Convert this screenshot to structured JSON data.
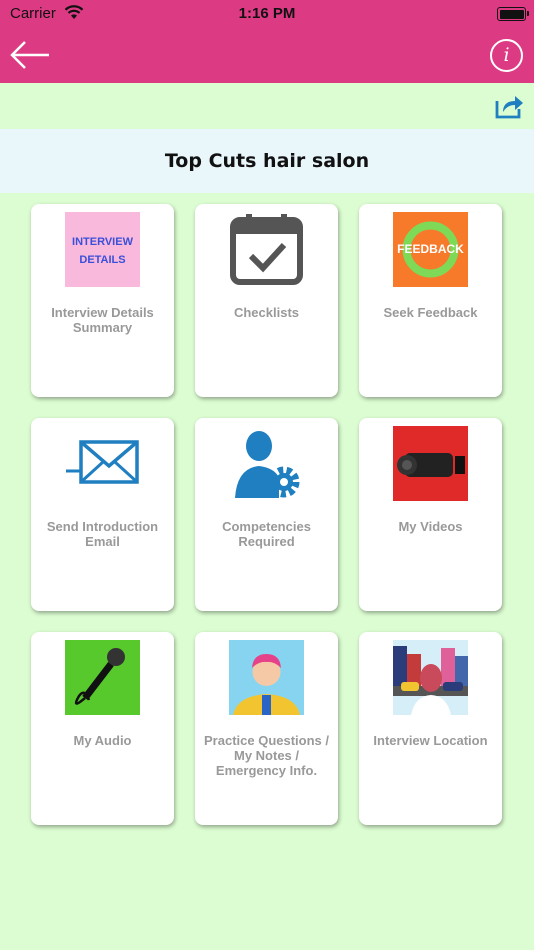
{
  "status_bar": {
    "carrier": "Carrier",
    "time": "1:16 PM"
  },
  "nav": {
    "back_icon": "arrow-left-icon",
    "info_icon": "info-icon",
    "info_label": "i"
  },
  "share_icon": "share-icon",
  "page_title": "Top Cuts hair salon",
  "colors": {
    "nav": "#dd3a84",
    "background": "#dcfdd2",
    "title_band": "#e9f7fb",
    "label": "#999999"
  },
  "tiles": [
    {
      "label": "Interview Details Summary",
      "icon": "interview-details-image",
      "image_text": [
        "INTERVIEW",
        "DETAILS"
      ]
    },
    {
      "label": "Checklists",
      "icon": "calendar-check-icon"
    },
    {
      "label": "Seek Feedback",
      "icon": "feedback-image",
      "image_text": "FEEDBACK"
    },
    {
      "label": "Send Introduction Email",
      "icon": "email-icon"
    },
    {
      "label": "Competencies Required",
      "icon": "person-gear-icon"
    },
    {
      "label": "My Videos",
      "icon": "video-camera-image"
    },
    {
      "label": "My Audio",
      "icon": "microphone-image"
    },
    {
      "label": "Practice Questions / My Notes / Emergency Info.",
      "icon": "person-image"
    },
    {
      "label": "Interview Location",
      "icon": "location-image"
    }
  ]
}
